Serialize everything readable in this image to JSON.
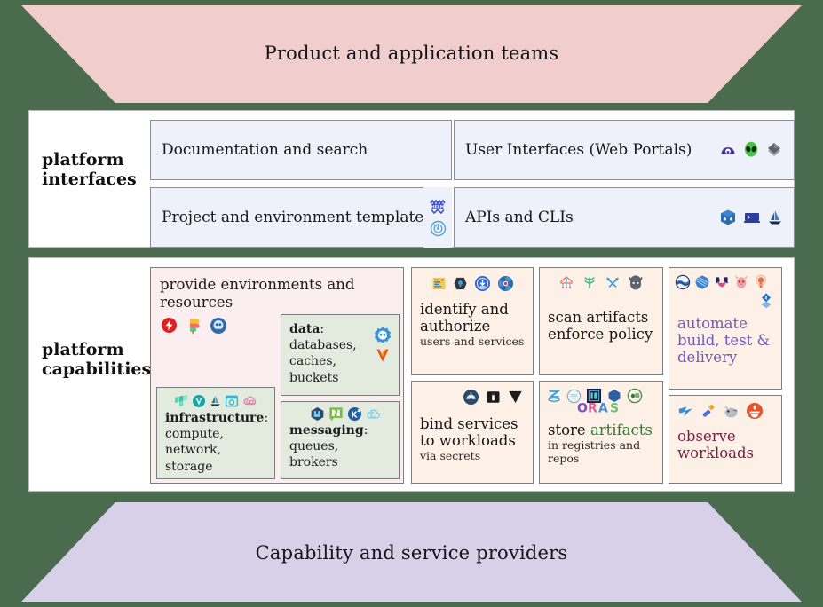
{
  "palette": {
    "background": "#4a6b4d",
    "top_band": "#f2cdcd",
    "bottom_band": "#d8d0e8",
    "panel": "#ffffff",
    "interface_box": "#eef1fa",
    "provide_box": "#fbeef0",
    "nested_green_box": "#e3eade",
    "peach_box": "#fdf0e7",
    "purple_text": "#6b5bbd",
    "maroon_text": "#7d1f3d",
    "green_text": "#2e7d32"
  },
  "bands": {
    "top": {
      "label": "Product and application teams"
    },
    "bottom": {
      "label": "Capability and service providers"
    }
  },
  "interfaces": {
    "section_title": "platform\ninterfaces",
    "section_title_line1": "platform",
    "section_title_line2": "interfaces",
    "boxes": [
      {
        "id": "documentation",
        "label": "Documentation and search",
        "icons": []
      },
      {
        "id": "templates",
        "label": "Project and environment templates",
        "icons": [
          "helm-icon",
          "argo-cd-icon"
        ]
      },
      {
        "id": "portals",
        "label": "User Interfaces (Web Portals)",
        "icons": [
          "backstage-icon",
          "alien-icon",
          "port-icon"
        ]
      },
      {
        "id": "apis-clis",
        "label": "APIs and CLIs",
        "icons": [
          "kubernetes-cube-icon",
          "terminal-icon",
          "sailboat-icon"
        ]
      }
    ]
  },
  "capabilities": {
    "section_title_line1": "platform",
    "section_title_line2": "capabilities",
    "provide": {
      "title_line1": "provide environments and",
      "title_line2": "resources",
      "icons": [
        "crossplane-icon",
        "pulumi-icon",
        "cluster-api-icon"
      ],
      "nested": {
        "infrastructure": {
          "icons": [
            "terraform-icon",
            "vault-icon",
            "sailboat-small-icon",
            "registry-icon",
            "cloud-link-icon"
          ],
          "bold_label": "infrastructure",
          "colon": ":",
          "body": "compute,\nnetwork,\nstorage",
          "body_line1": "compute,",
          "body_line2": "network,",
          "body_line3": "storage"
        },
        "data": {
          "bold_label": "data",
          "colon": ":",
          "body_line1": "databases,",
          "body_line2": "caches,",
          "body_line3": "buckets",
          "icons": [
            "cloudnative-pg-icon",
            "vitess-icon"
          ]
        },
        "messaging": {
          "icons": [
            "rabbitmq-icon",
            "nats-icon",
            "kafka-icon",
            "cloud-events-icon"
          ],
          "bold_label": "messaging",
          "colon": ":",
          "body_line1": "queues,",
          "body_line2": "brokers"
        }
      }
    },
    "cards": [
      {
        "id": "identify",
        "icons": [
          "spicedb-icon",
          "keycloak-icon",
          "dex-icon",
          "spire-icon"
        ],
        "title_line1": "identify and",
        "title_line2": "authorize",
        "subtitle": "users and services"
      },
      {
        "id": "bind",
        "icons": [
          "service-binding-icon",
          "external-secrets-icon",
          "vault-secrets-icon"
        ],
        "title_line1": "bind services",
        "title_line2": "to workloads",
        "subtitle": "via secrets"
      },
      {
        "id": "scan",
        "icons": [
          "kyverno-icon",
          "opa-icon",
          "falco-icon",
          "trivy-icon"
        ],
        "title_line1": "scan artifacts",
        "title_line2": "enforce policy",
        "subtitle": ""
      },
      {
        "id": "store",
        "icons": [
          "zot-icon",
          "harbor-icon",
          "ci-registry-icon",
          "hexagon-icon",
          "distribution-icon",
          "oras-icon"
        ],
        "title_prefix": "store ",
        "title_accent": "artifacts",
        "subtitle_line1": "in registries and",
        "subtitle_line2": "repos"
      },
      {
        "id": "automate",
        "icons": [
          "argo-icon",
          "flux-icon",
          "tekton-icon",
          "jenkins-icon",
          "dagger-icon"
        ],
        "title_line1": "automate",
        "title_line2": "build, test &",
        "title_line3": "delivery"
      },
      {
        "id": "observe",
        "icons": [
          "fluentd-icon",
          "opentelemetry-icon",
          "grafana-icon",
          "prometheus-icon"
        ],
        "title_line1": "observe",
        "title_line2": "workloads"
      }
    ]
  }
}
